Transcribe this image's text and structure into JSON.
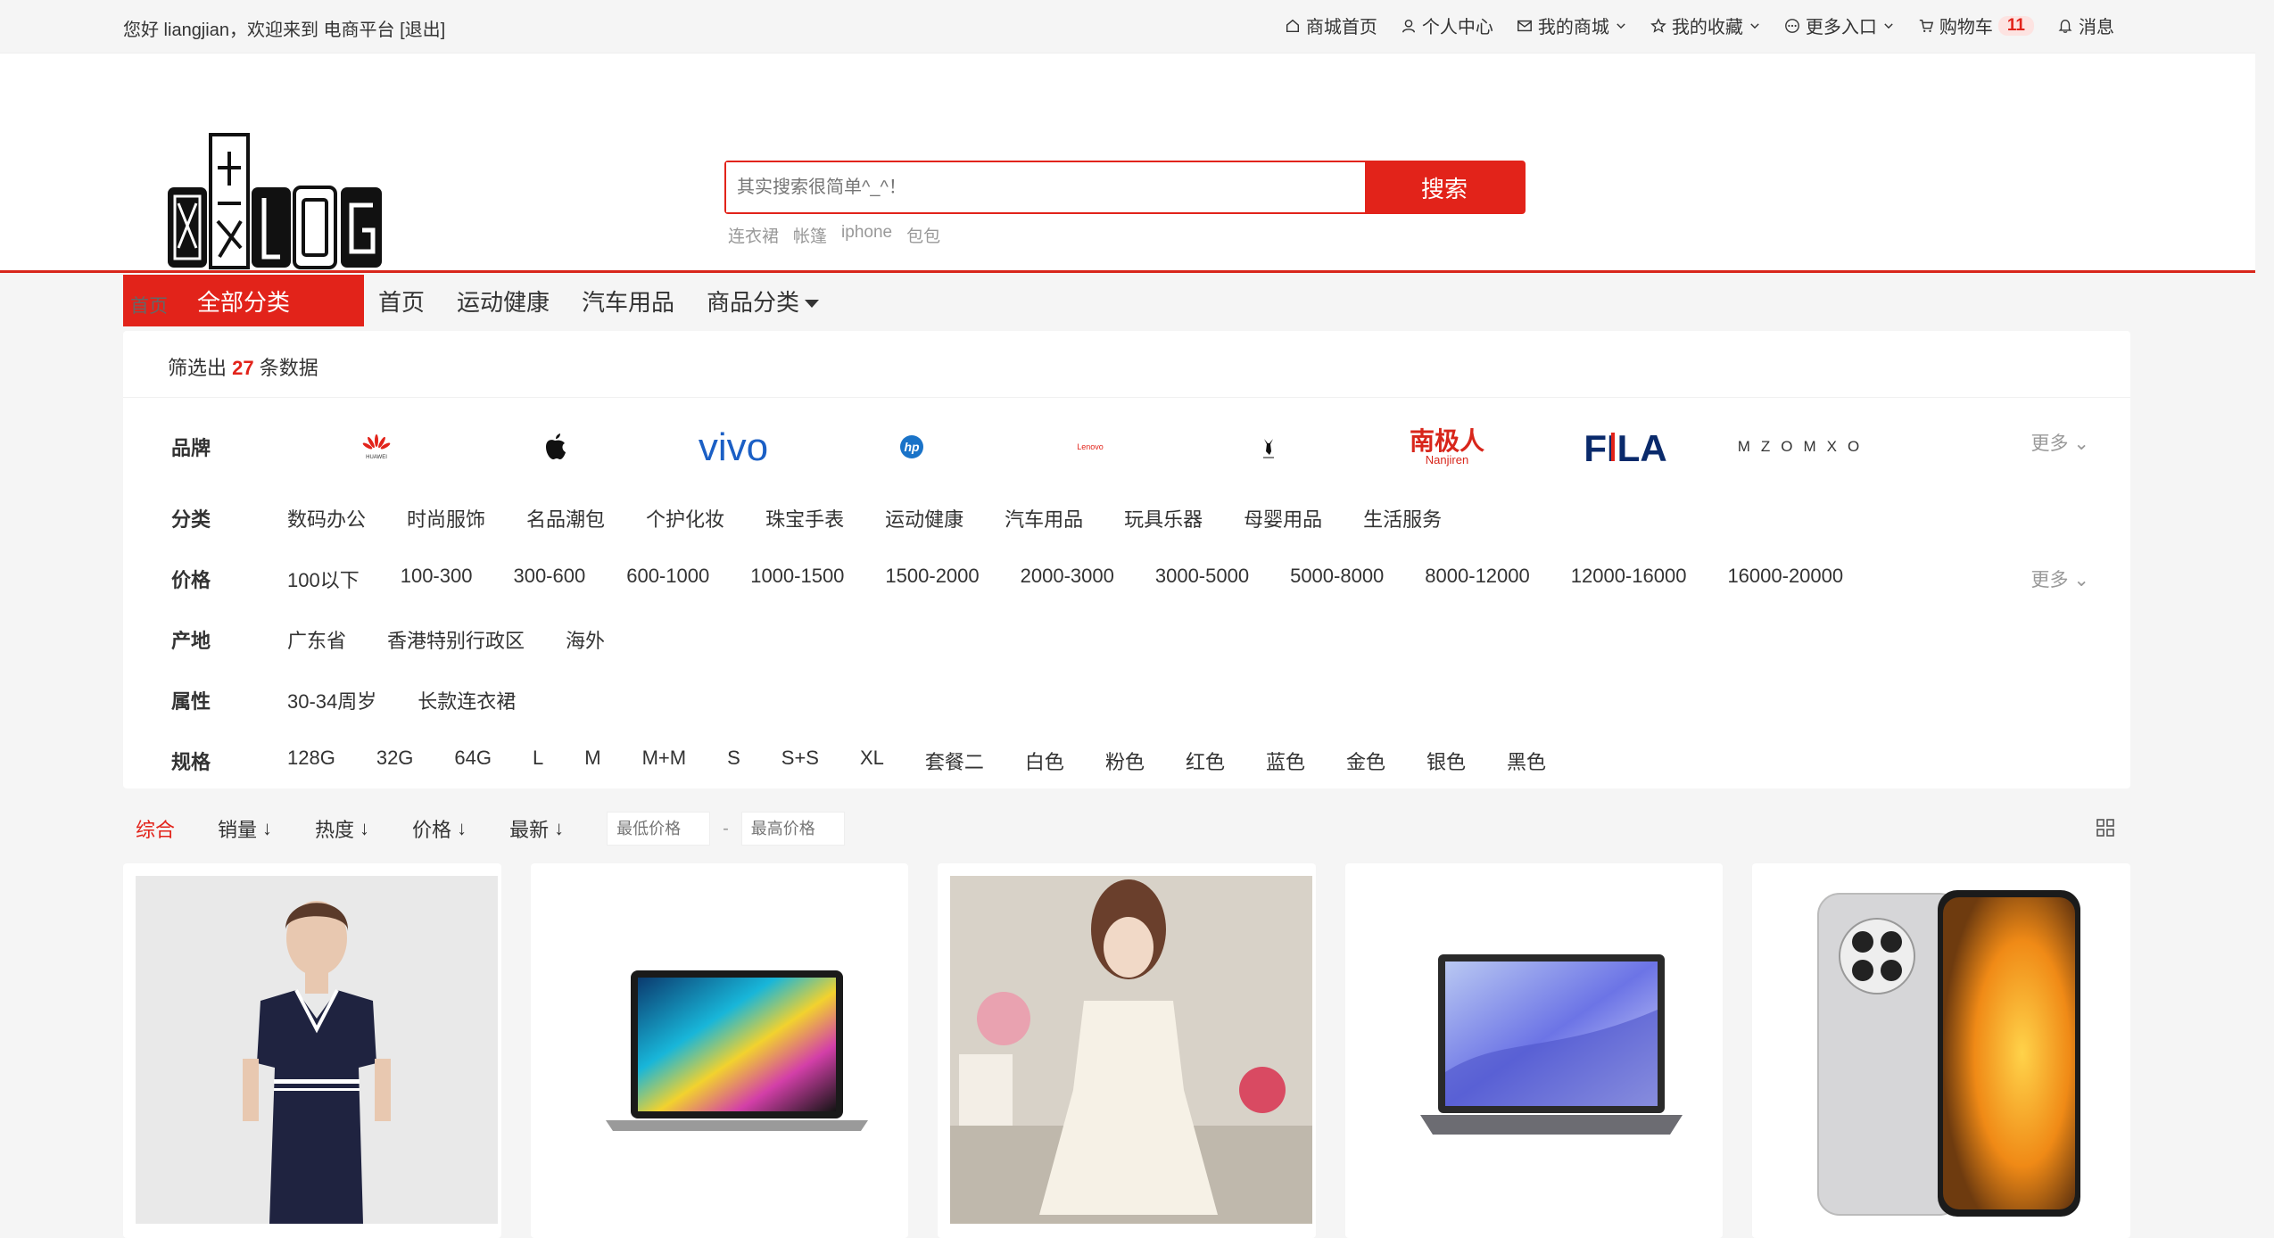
{
  "topbar": {
    "welcome_prefix": "您好 liangjian，欢迎来到 电商平台",
    "logout": "[退出]",
    "links": [
      {
        "icon": "home-icon",
        "label": "商城首页"
      },
      {
        "icon": "user-icon",
        "label": "个人中心"
      },
      {
        "icon": "mail-icon",
        "label": "我的商城",
        "dropdown": true
      },
      {
        "icon": "star-icon",
        "label": "我的收藏",
        "dropdown": true
      },
      {
        "icon": "more-circle-icon",
        "label": "更多入口",
        "dropdown": true
      },
      {
        "icon": "cart-icon",
        "label": "购物车",
        "badge": "11"
      },
      {
        "icon": "bell-icon",
        "label": "消息"
      }
    ]
  },
  "search": {
    "placeholder": "其实搜索很简单^_^！",
    "button": "搜索",
    "hot_words": [
      "连衣裙",
      "帐篷",
      "iphone",
      "包包"
    ]
  },
  "nav": {
    "all_categories": "全部分类",
    "links": [
      "首页",
      "运动健康",
      "汽车用品",
      "商品分类"
    ]
  },
  "breadcrumb": "首页",
  "filter": {
    "count_prefix": "筛选出",
    "count": "27",
    "count_suffix": "条数据",
    "more": "更多",
    "brand_label": "品牌",
    "brands": [
      "HUAWEI",
      "Apple",
      "vivo",
      "hp",
      "Lenovo",
      "Playboy",
      "南极人 Nanjiren",
      "FILA",
      "MZOMXO"
    ],
    "category_label": "分类",
    "categories": [
      "数码办公",
      "时尚服饰",
      "名品潮包",
      "个护化妆",
      "珠宝手表",
      "运动健康",
      "汽车用品",
      "玩具乐器",
      "母婴用品",
      "生活服务"
    ],
    "price_label": "价格",
    "prices": [
      "100以下",
      "100-300",
      "300-600",
      "600-1000",
      "1000-1500",
      "1500-2000",
      "2000-3000",
      "3000-5000",
      "5000-8000",
      "8000-12000",
      "12000-16000",
      "16000-20000"
    ],
    "origin_label": "产地",
    "origins": [
      "广东省",
      "香港特别行政区",
      "海外"
    ],
    "attr_label": "属性",
    "attrs": [
      "30-34周岁",
      "长款连衣裙"
    ],
    "spec_label": "规格",
    "specs": [
      "128G",
      "32G",
      "64G",
      "L",
      "M",
      "M+M",
      "S",
      "S+S",
      "XL",
      "套餐二",
      "白色",
      "粉色",
      "红色",
      "蓝色",
      "金色",
      "银色",
      "黑色"
    ]
  },
  "sort": {
    "items": [
      "综合",
      "销量",
      "热度",
      "价格",
      "最新"
    ],
    "min_price_placeholder": "最低价格",
    "max_price_placeholder": "最高价格",
    "dash": "-"
  },
  "products": [
    {
      "name": "navy-dress"
    },
    {
      "name": "laptop-dark"
    },
    {
      "name": "white-dress"
    },
    {
      "name": "laptop-blue"
    },
    {
      "name": "huawei-phone"
    }
  ],
  "colors": {
    "accent": "#e2231a"
  }
}
